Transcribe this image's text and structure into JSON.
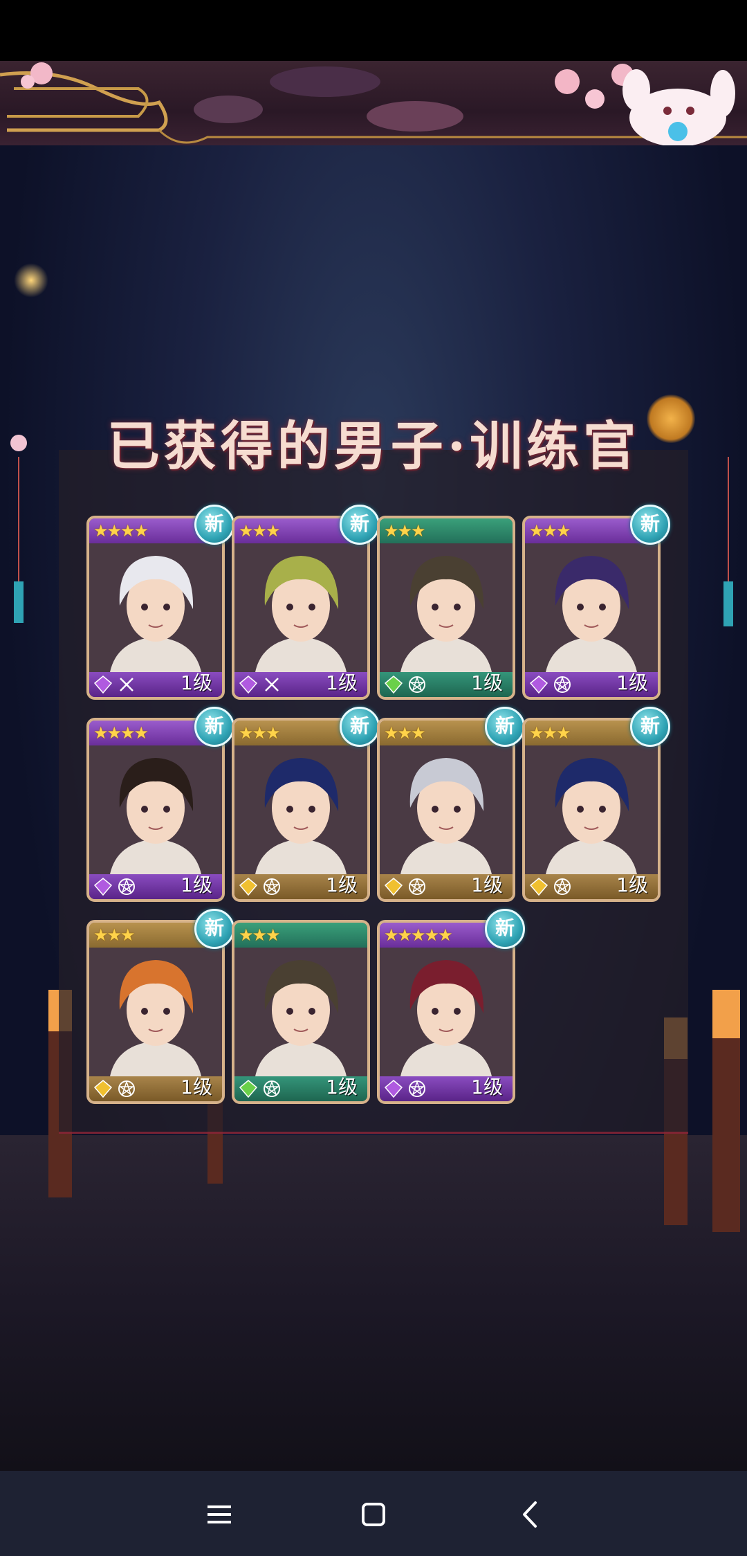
{
  "title": "已获得的男子·训练官",
  "colors": {
    "purple": "#7b3fb0",
    "gold": "#a07a3a",
    "green": "#2f8a6a",
    "badge": "#2fa3b4"
  },
  "cards": [
    {
      "stars": "★★★★",
      "level": "1级",
      "new": "新",
      "theme": "purple",
      "gem": "purple-gem-icon",
      "role": "crossed-swords-icon",
      "hair": "#e8e8ee"
    },
    {
      "stars": "★★★",
      "level": "1级",
      "new": "新",
      "theme": "purple",
      "gem": "purple-gem-icon",
      "role": "crossed-swords-icon",
      "hair": "#a8b04a"
    },
    {
      "stars": "★★★",
      "level": "1级",
      "new": "",
      "theme": "green",
      "gem": "green-leaf-icon",
      "role": "pentagram-icon",
      "hair": "#4a4032"
    },
    {
      "stars": "★★★",
      "level": "1级",
      "new": "新",
      "theme": "purple",
      "gem": "purple-gem-icon",
      "role": "pentagram-icon",
      "hair": "#3a2a6a"
    },
    {
      "stars": "★★★★",
      "level": "1级",
      "new": "新",
      "theme": "purple",
      "gem": "purple-gem-icon",
      "role": "pentagram-icon",
      "hair": "#2a1e1a"
    },
    {
      "stars": "★★★",
      "level": "1级",
      "new": "新",
      "theme": "gold",
      "gem": "gold-gem-icon",
      "role": "pentagram-icon",
      "hair": "#1e2a6a"
    },
    {
      "stars": "★★★",
      "level": "1级",
      "new": "新",
      "theme": "gold",
      "gem": "gold-gem-icon",
      "role": "pentagram-icon",
      "hair": "#c8cad4"
    },
    {
      "stars": "★★★",
      "level": "1级",
      "new": "新",
      "theme": "gold",
      "gem": "gold-gem-icon",
      "role": "pentagram-icon",
      "hair": "#1e2a6a"
    },
    {
      "stars": "★★★",
      "level": "1级",
      "new": "新",
      "theme": "gold",
      "gem": "gold-gem-icon",
      "role": "pentagram-icon",
      "hair": "#d8742e"
    },
    {
      "stars": "★★★",
      "level": "1级",
      "new": "",
      "theme": "green",
      "gem": "green-leaf-icon",
      "role": "pentagram-icon",
      "hair": "#4a4032"
    },
    {
      "stars": "★★★★★",
      "level": "1级",
      "new": "新",
      "theme": "purple",
      "gem": "purple-gem-icon",
      "role": "pentagram-icon",
      "hair": "#7a1e2e"
    }
  ],
  "nav": {
    "menu_icon": "menu-icon",
    "home_icon": "home-square-icon",
    "back_icon": "back-chevron-icon"
  }
}
